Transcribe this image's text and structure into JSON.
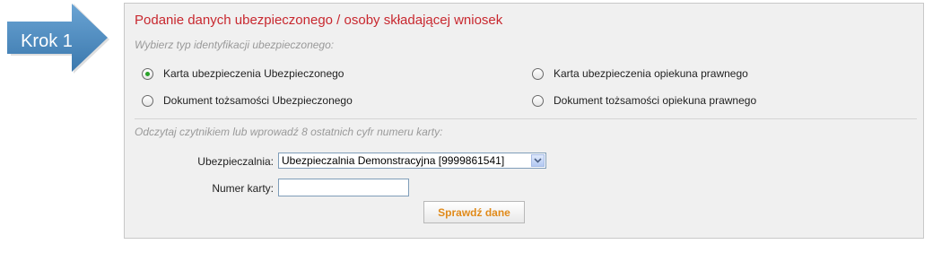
{
  "step": {
    "label": "Krok 1"
  },
  "panel": {
    "title": "Podanie danych ubezpieczonego / osoby składającej wniosek",
    "subtitle": "Wybierz typ identyfikacji ubezpieczonego:",
    "id_options": [
      {
        "label": "Karta ubezpieczenia Ubezpieczonego",
        "checked": true
      },
      {
        "label": "Karta ubezpieczenia opiekuna prawnego",
        "checked": false
      },
      {
        "label": "Dokument tożsamości Ubezpieczonego",
        "checked": false
      },
      {
        "label": "Dokument tożsamości opiekuna prawnego",
        "checked": false
      }
    ],
    "hint": "Odczytaj czytnikiem lub wprowadź 8 ostatnich cyfr numeru karty:",
    "insurer": {
      "label": "Ubezpieczalnia:",
      "selected": "Ubezpieczalnia Demonstracyjna [9999861541]"
    },
    "card_number": {
      "label": "Numer karty:",
      "value": ""
    },
    "check_button": "Sprawdź dane"
  },
  "colors": {
    "title": "#c8282f",
    "arrow": "#4a86b8",
    "button_text": "#e08a1a",
    "radio_checked": "#2aa22a"
  }
}
